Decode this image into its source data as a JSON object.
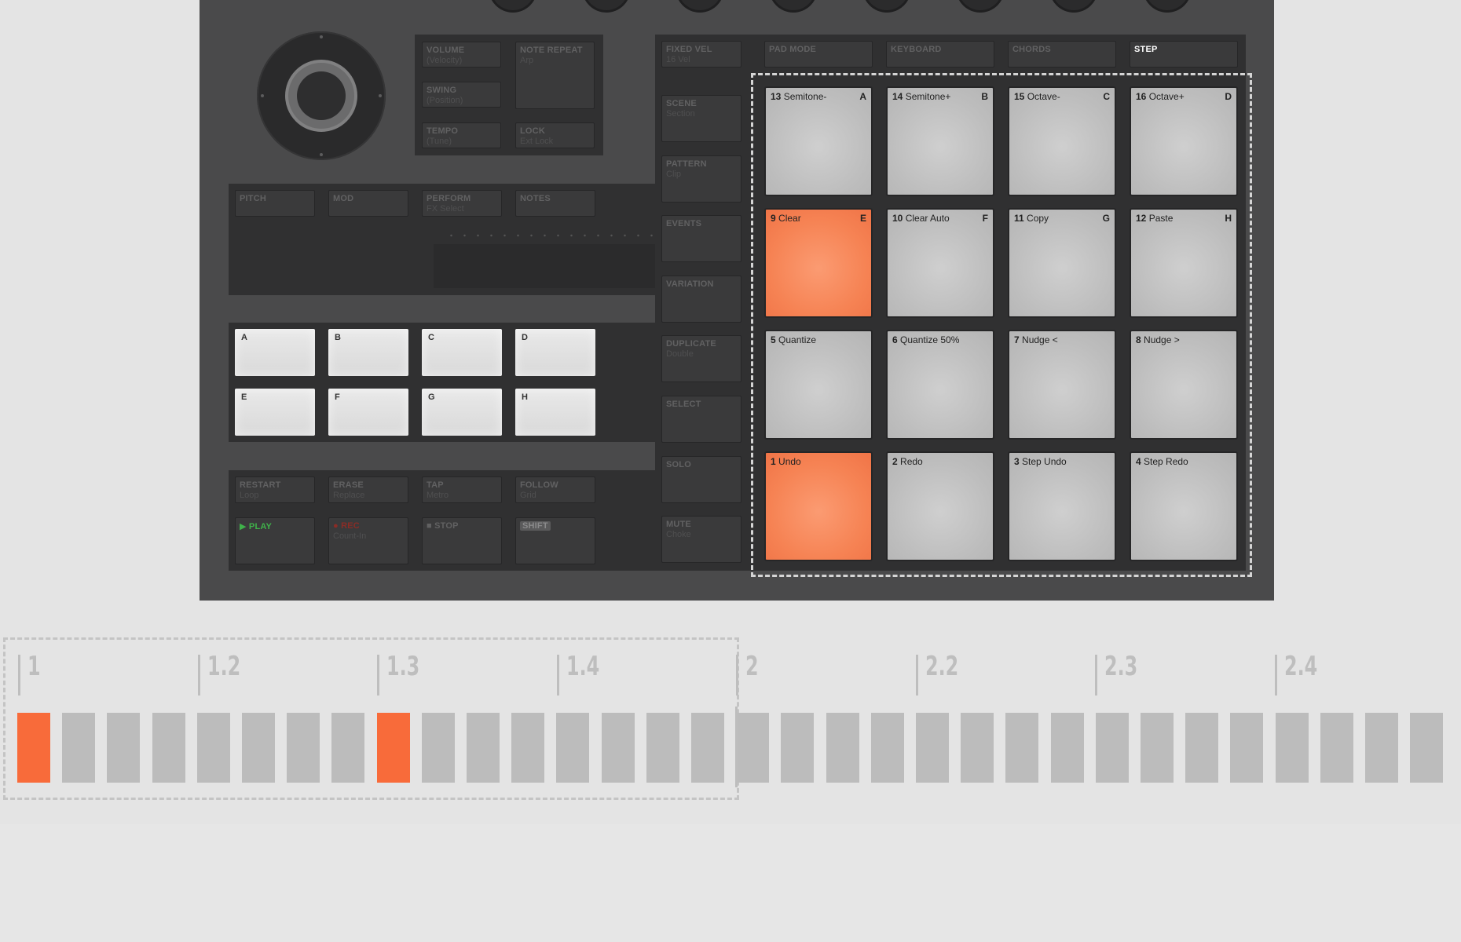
{
  "device": {
    "transport_buttons": [
      {
        "label": "VOLUME",
        "sub": "(Velocity)"
      },
      {
        "label": "NOTE REPEAT",
        "sub": "Arp"
      },
      {
        "label": "SWING",
        "sub": "(Position)"
      },
      {
        "label": "TEMPO",
        "sub": "(Tune)"
      },
      {
        "label": "LOCK",
        "sub": "Ext Lock"
      }
    ],
    "strip_buttons": [
      {
        "label": "PITCH",
        "sub": ""
      },
      {
        "label": "MOD",
        "sub": ""
      },
      {
        "label": "PERFORM",
        "sub": "FX Select"
      },
      {
        "label": "NOTES",
        "sub": ""
      }
    ],
    "group_pads": [
      "A",
      "B",
      "C",
      "D",
      "E",
      "F",
      "G",
      "H"
    ],
    "transport_top": [
      {
        "label": "RESTART",
        "sub": "Loop"
      },
      {
        "label": "ERASE",
        "sub": "Replace"
      },
      {
        "label": "TAP",
        "sub": "Metro"
      },
      {
        "label": "FOLLOW",
        "sub": "Grid"
      }
    ],
    "transport_bottom": [
      {
        "label": "▶ PLAY",
        "sub": ""
      },
      {
        "label": "● REC",
        "sub": "Count-In"
      },
      {
        "label": "■ STOP",
        "sub": ""
      },
      {
        "label": "SHIFT",
        "sub": ""
      }
    ],
    "mode_buttons": [
      {
        "label": "FIXED VEL",
        "sub": "16 Vel"
      },
      {
        "label": "PAD MODE",
        "sub": ""
      },
      {
        "label": "KEYBOARD",
        "sub": ""
      },
      {
        "label": "CHORDS",
        "sub": ""
      },
      {
        "label": "STEP",
        "sub": "",
        "active": true
      }
    ],
    "side_buttons": [
      {
        "label": "SCENE",
        "sub": "Section"
      },
      {
        "label": "PATTERN",
        "sub": "Clip"
      },
      {
        "label": "EVENTS",
        "sub": ""
      },
      {
        "label": "VARIATION",
        "sub": ""
      },
      {
        "label": "DUPLICATE",
        "sub": "Double"
      },
      {
        "label": "SELECT",
        "sub": ""
      },
      {
        "label": "SOLO",
        "sub": ""
      },
      {
        "label": "MUTE",
        "sub": "Choke"
      }
    ],
    "pads": [
      {
        "num": "13",
        "label": "Semitone-",
        "letter": "A",
        "lit": false
      },
      {
        "num": "14",
        "label": "Semitone+",
        "letter": "B",
        "lit": false
      },
      {
        "num": "15",
        "label": "Octave-",
        "letter": "C",
        "lit": false
      },
      {
        "num": "16",
        "label": "Octave+",
        "letter": "D",
        "lit": false
      },
      {
        "num": "9",
        "label": "Clear",
        "letter": "E",
        "lit": true
      },
      {
        "num": "10",
        "label": "Clear Auto",
        "letter": "F",
        "lit": false
      },
      {
        "num": "11",
        "label": "Copy",
        "letter": "G",
        "lit": false
      },
      {
        "num": "12",
        "label": "Paste",
        "letter": "H",
        "lit": false
      },
      {
        "num": "5",
        "label": "Quantize",
        "letter": "",
        "lit": false
      },
      {
        "num": "6",
        "label": "Quantize 50%",
        "letter": "",
        "lit": false
      },
      {
        "num": "7",
        "label": "Nudge <",
        "letter": "",
        "lit": false
      },
      {
        "num": "8",
        "label": "Nudge >",
        "letter": "",
        "lit": false
      },
      {
        "num": "1",
        "label": "Undo",
        "letter": "",
        "lit": true
      },
      {
        "num": "2",
        "label": "Redo",
        "letter": "",
        "lit": false
      },
      {
        "num": "3",
        "label": "Step Undo",
        "letter": "",
        "lit": false
      },
      {
        "num": "4",
        "label": "Step Redo",
        "letter": "",
        "lit": false
      }
    ]
  },
  "timeline": {
    "ticks": [
      "1",
      "1.2",
      "1.3",
      "1.4",
      "2",
      "2.2",
      "2.3",
      "2.4"
    ],
    "step_count": 32,
    "active_steps": [
      0,
      8
    ]
  },
  "colors": {
    "accent_orange": "#f68354",
    "step_active": "#f86b3a",
    "step_idle": "#bcbcbc",
    "play_green": "#3fb24a",
    "device_body": "#4a4a4b"
  }
}
